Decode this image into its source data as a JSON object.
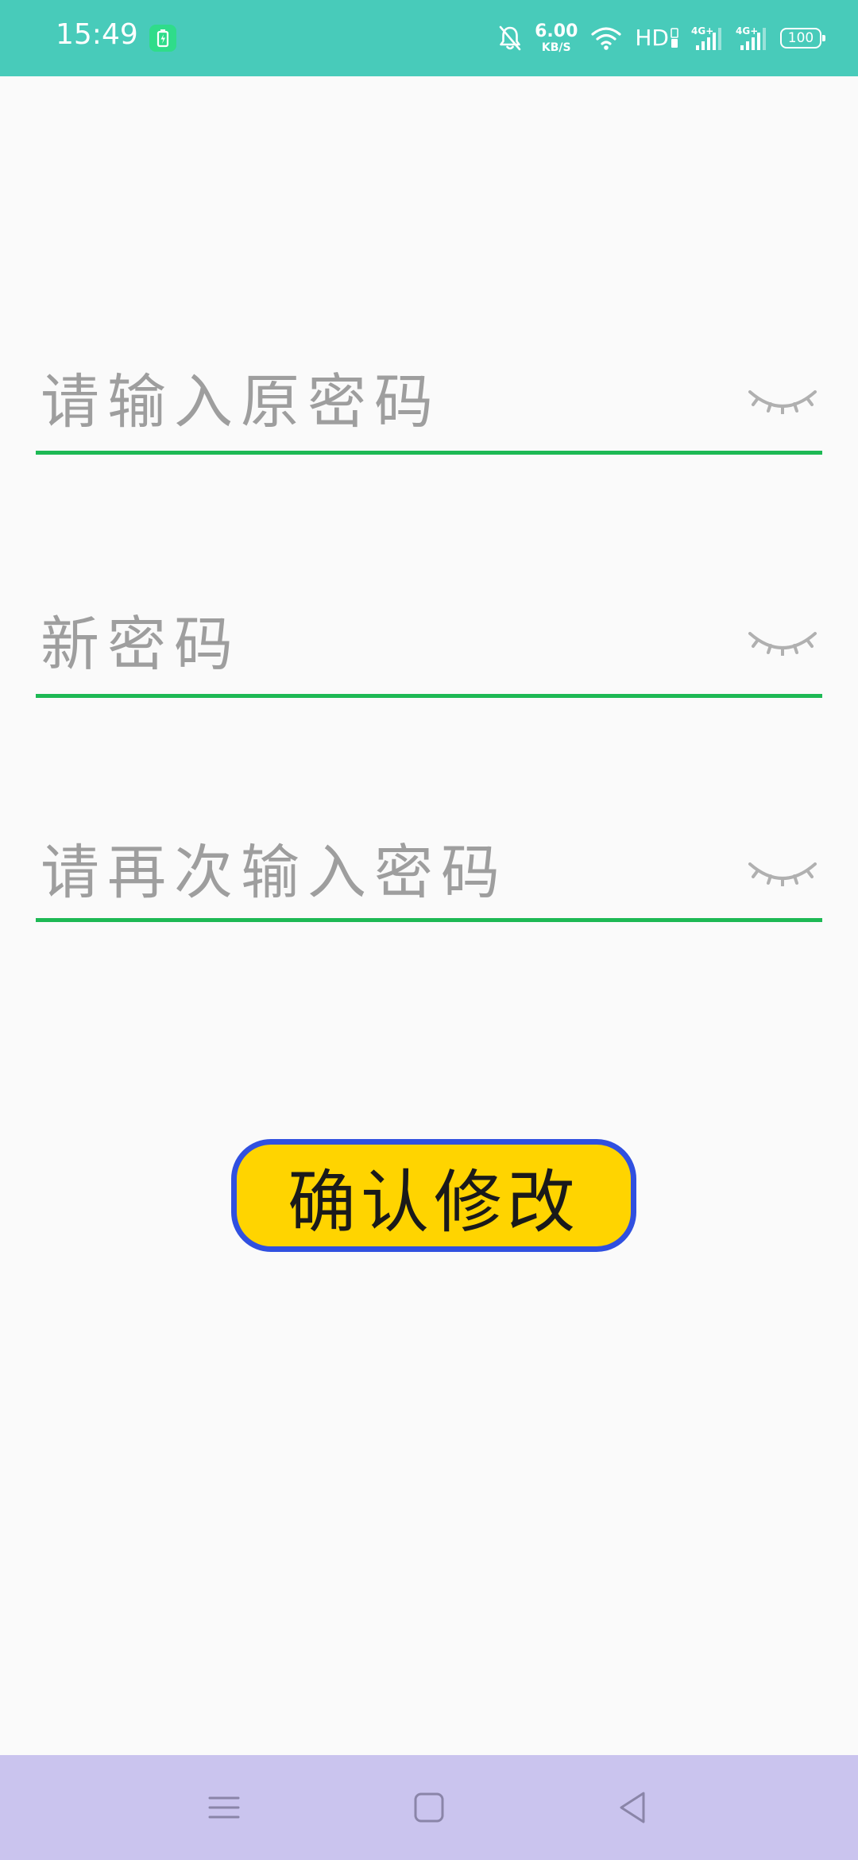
{
  "status_bar": {
    "time": "15:49",
    "net_speed_value": "6.00",
    "net_speed_unit": "KB/S",
    "hd_label": "HD",
    "battery_level": "100",
    "icons": [
      "battery-saver-icon",
      "bell-muted-icon",
      "wifi-icon",
      "signal-4g-icon",
      "signal-4g-icon",
      "battery-icon"
    ],
    "background_color": "#48CBBA"
  },
  "form": {
    "fields": [
      {
        "placeholder": "请输入原密码",
        "value": "",
        "toggle_icon": "eye-closed-icon"
      },
      {
        "placeholder": "新密码",
        "value": "",
        "toggle_icon": "eye-closed-icon"
      },
      {
        "placeholder": "请再次输入密码",
        "value": "",
        "toggle_icon": "eye-closed-icon"
      }
    ],
    "underline_color": "#1DB954",
    "placeholder_color": "#9E9E9E"
  },
  "confirm_button": {
    "label": "确认修改",
    "fill_color": "#FFD400",
    "border_color": "#3050E0"
  },
  "nav_bar": {
    "buttons": [
      "menu-icon",
      "home-icon",
      "back-icon"
    ],
    "background_color": "#CAC4EE"
  }
}
